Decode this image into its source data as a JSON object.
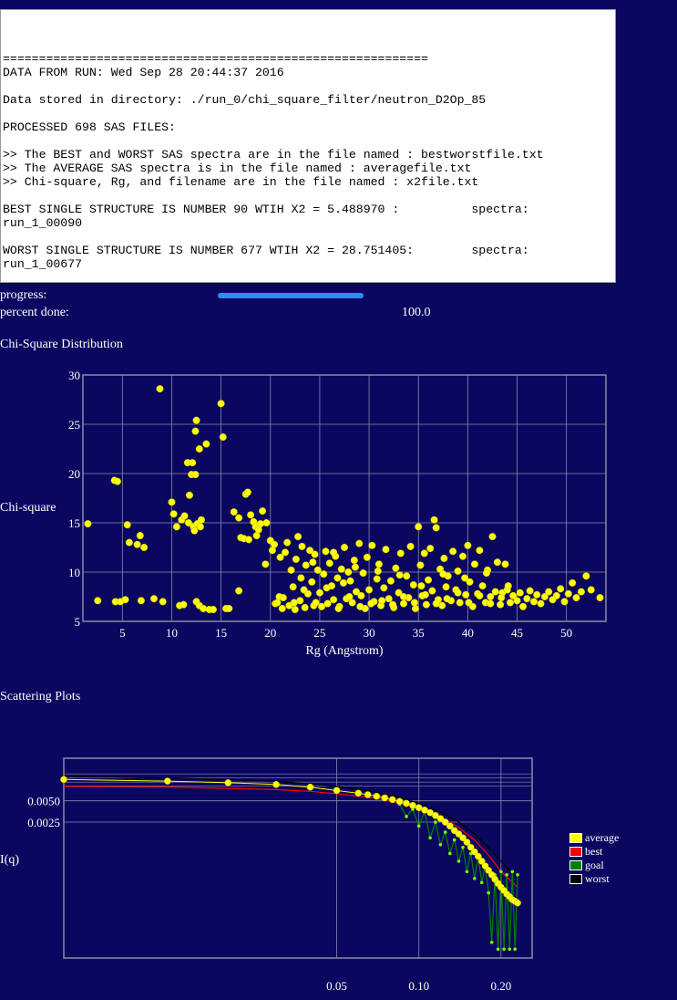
{
  "output": {
    "lines": [
      "===========================================================",
      "DATA FROM RUN: Wed Sep 28 20:44:37 2016",
      "",
      "Data stored in directory: ./run_0/chi_square_filter/neutron_D2Op_85",
      "",
      "PROCESSED 698 SAS FILES:",
      "",
      ">> The BEST and WORST SAS spectra are in the file named : bestworstfile.txt",
      ">> The AVERAGE SAS spectra is in the file named : averagefile.txt",
      ">> Chi-square, Rg, and filename are in the file named : x2file.txt",
      "",
      "BEST SINGLE STRUCTURE IS NUMBER 90 WTIH X2 = 5.488970 :          spectra:",
      "run_1_00090",
      "",
      "WORST SINGLE STRUCTURE IS NUMBER 677 WTIH X2 = 28.751405:        spectra:",
      "run_1_00677",
      "",
      "==========================================================="
    ]
  },
  "progress": {
    "label": "progress:",
    "fraction": 1.0,
    "percent_label": "percent done:",
    "percent_value": "100.0"
  },
  "chi_title": "Chi-Square Distribution",
  "scatter_title": "Scattering Plots",
  "colors": {
    "background": "#0b0760",
    "points": "#ffff00",
    "grid": "#8a8aa8",
    "progress": "#2f8bf0",
    "average": "#ffff00",
    "best": "#ff0000",
    "goal": "#008000",
    "worst": "#000000"
  },
  "chart_data": [
    {
      "type": "scatter",
      "title": "",
      "xlabel": "Rg (Angstrom)",
      "ylabel": "Chi-square",
      "xlim": [
        1,
        54
      ],
      "ylim": [
        5,
        30
      ],
      "xticks": [
        5,
        10,
        15,
        20,
        25,
        30,
        35,
        40,
        45,
        50
      ],
      "yticks": [
        5,
        10,
        15,
        20,
        25,
        30
      ],
      "grid": true,
      "points": [
        [
          1.5,
          14.9
        ],
        [
          2.5,
          7.1
        ],
        [
          4.2,
          19.3
        ],
        [
          4.5,
          19.2
        ],
        [
          4.3,
          7.0
        ],
        [
          4.8,
          7.0
        ],
        [
          5.3,
          7.2
        ],
        [
          5.5,
          14.8
        ],
        [
          5.7,
          13.0
        ],
        [
          6.5,
          12.8
        ],
        [
          6.8,
          13.7
        ],
        [
          7.2,
          12.5
        ],
        [
          6.9,
          7.1
        ],
        [
          8.2,
          7.3
        ],
        [
          8.8,
          28.6
        ],
        [
          9.1,
          7.0
        ],
        [
          10.0,
          17.1
        ],
        [
          10.2,
          15.9
        ],
        [
          10.5,
          14.6
        ],
        [
          10.8,
          6.6
        ],
        [
          11.2,
          6.7
        ],
        [
          11.0,
          15.3
        ],
        [
          11.3,
          15.7
        ],
        [
          11.6,
          21.1
        ],
        [
          11.7,
          15.0
        ],
        [
          11.8,
          17.8
        ],
        [
          12.0,
          19.9
        ],
        [
          12.1,
          21.1
        ],
        [
          12.2,
          14.6
        ],
        [
          12.3,
          14.2
        ],
        [
          12.4,
          19.9
        ],
        [
          12.4,
          24.3
        ],
        [
          12.5,
          25.4
        ],
        [
          12.6,
          14.9
        ],
        [
          12.8,
          22.5
        ],
        [
          12.9,
          14.6
        ],
        [
          12.5,
          7.0
        ],
        [
          12.8,
          6.6
        ],
        [
          13.0,
          15.3
        ],
        [
          13.2,
          6.3
        ],
        [
          13.5,
          23.0
        ],
        [
          13.8,
          6.2
        ],
        [
          14.2,
          6.2
        ],
        [
          15.0,
          27.1
        ],
        [
          15.2,
          23.7
        ],
        [
          15.5,
          6.3
        ],
        [
          15.8,
          6.3
        ],
        [
          16.3,
          16.1
        ],
        [
          16.8,
          15.5
        ],
        [
          17.0,
          13.5
        ],
        [
          16.8,
          8.1
        ],
        [
          17.3,
          13.4
        ],
        [
          17.5,
          17.9
        ],
        [
          17.7,
          18.1
        ],
        [
          17.8,
          13.3
        ],
        [
          18.0,
          15.8
        ],
        [
          18.3,
          15.1
        ],
        [
          18.5,
          14.6
        ],
        [
          18.6,
          13.7
        ],
        [
          18.8,
          14.3
        ],
        [
          19.0,
          14.9
        ],
        [
          19.2,
          16.2
        ],
        [
          19.5,
          10.8
        ],
        [
          19.6,
          15.0
        ],
        [
          20.0,
          13.2
        ],
        [
          20.2,
          12.2
        ],
        [
          20.4,
          12.8
        ],
        [
          20.5,
          6.8
        ],
        [
          20.7,
          6.9
        ],
        [
          20.9,
          7.5
        ],
        [
          21.0,
          11.5
        ],
        [
          21.2,
          6.3
        ],
        [
          21.3,
          7.4
        ],
        [
          21.5,
          12.0
        ],
        [
          21.7,
          13.0
        ],
        [
          21.9,
          6.6
        ],
        [
          22.1,
          10.2
        ],
        [
          22.3,
          8.5
        ],
        [
          22.5,
          6.2
        ],
        [
          22.6,
          11.3
        ],
        [
          22.8,
          13.6
        ],
        [
          23.0,
          7.1
        ],
        [
          23.1,
          9.4
        ],
        [
          23.2,
          12.6
        ],
        [
          23.5,
          6.4
        ],
        [
          23.6,
          10.7
        ],
        [
          23.8,
          7.8
        ],
        [
          24.0,
          12.2
        ],
        [
          24.2,
          9.0
        ],
        [
          24.4,
          6.6
        ],
        [
          24.5,
          11.8
        ],
        [
          24.8,
          10.2
        ],
        [
          25.0,
          7.9
        ],
        [
          25.2,
          6.5
        ],
        [
          25.4,
          9.8
        ],
        [
          25.6,
          12.1
        ],
        [
          25.8,
          6.8
        ],
        [
          26.0,
          10.9
        ],
        [
          26.2,
          8.6
        ],
        [
          26.4,
          7.2
        ],
        [
          26.6,
          11.6
        ],
        [
          26.8,
          9.4
        ],
        [
          27.0,
          6.5
        ],
        [
          27.2,
          10.3
        ],
        [
          27.4,
          8.9
        ],
        [
          27.5,
          12.5
        ],
        [
          27.7,
          7.3
        ],
        [
          27.9,
          10.0
        ],
        [
          28.1,
          9.1
        ],
        [
          28.3,
          6.9
        ],
        [
          28.5,
          11.2
        ],
        [
          28.7,
          8.0
        ],
        [
          29.0,
          12.9
        ],
        [
          29.2,
          7.6
        ],
        [
          29.4,
          9.9
        ],
        [
          29.6,
          6.3
        ],
        [
          29.8,
          11.5
        ],
        [
          30.0,
          8.2
        ],
        [
          30.3,
          12.7
        ],
        [
          30.5,
          7.0
        ],
        [
          30.8,
          9.3
        ],
        [
          31.0,
          10.8
        ],
        [
          31.2,
          6.6
        ],
        [
          31.5,
          8.4
        ],
        [
          31.7,
          12.3
        ],
        [
          32.0,
          7.3
        ],
        [
          32.2,
          9.1
        ],
        [
          32.5,
          6.4
        ],
        [
          32.7,
          10.4
        ],
        [
          33.0,
          7.9
        ],
        [
          33.2,
          11.9
        ],
        [
          33.5,
          6.8
        ],
        [
          33.8,
          9.6
        ],
        [
          34.0,
          7.4
        ],
        [
          34.2,
          12.6
        ],
        [
          34.5,
          8.7
        ],
        [
          34.7,
          6.3
        ],
        [
          35.0,
          14.6
        ],
        [
          35.2,
          10.7
        ],
        [
          35.4,
          7.6
        ],
        [
          35.6,
          11.9
        ],
        [
          35.8,
          6.7
        ],
        [
          36.0,
          9.2
        ],
        [
          36.2,
          12.4
        ],
        [
          36.4,
          8.1
        ],
        [
          36.6,
          15.3
        ],
        [
          36.8,
          14.5
        ],
        [
          37.0,
          7.2
        ],
        [
          37.2,
          10.3
        ],
        [
          37.4,
          6.6
        ],
        [
          37.6,
          11.4
        ],
        [
          37.8,
          8.5
        ],
        [
          38.0,
          9.6
        ],
        [
          38.3,
          7.1
        ],
        [
          38.5,
          12.1
        ],
        [
          38.8,
          8.2
        ],
        [
          39.0,
          10.1
        ],
        [
          39.2,
          6.9
        ],
        [
          39.5,
          11.6
        ],
        [
          39.8,
          7.7
        ],
        [
          40.0,
          12.7
        ],
        [
          40.2,
          9.0
        ],
        [
          40.5,
          6.5
        ],
        [
          40.7,
          10.8
        ],
        [
          41.0,
          7.8
        ],
        [
          41.2,
          12.2
        ],
        [
          41.5,
          8.6
        ],
        [
          41.8,
          6.9
        ],
        [
          42.0,
          10.2
        ],
        [
          42.3,
          7.5
        ],
        [
          42.5,
          13.6
        ],
        [
          42.8,
          8.0
        ],
        [
          43.0,
          11.0
        ],
        [
          43.3,
          6.7
        ],
        [
          43.5,
          7.9
        ],
        [
          43.8,
          10.8
        ],
        [
          44.0,
          8.2
        ],
        [
          44.3,
          6.9
        ],
        [
          44.6,
          7.6
        ],
        [
          45.0,
          7.1
        ],
        [
          45.3,
          7.9
        ],
        [
          45.6,
          6.5
        ],
        [
          46.0,
          7.3
        ],
        [
          46.3,
          8.1
        ],
        [
          46.7,
          7.0
        ],
        [
          47.0,
          7.7
        ],
        [
          47.4,
          6.8
        ],
        [
          47.8,
          7.5
        ],
        [
          48.2,
          8.0
        ],
        [
          48.6,
          7.2
        ],
        [
          49.0,
          7.6
        ],
        [
          49.4,
          8.3
        ],
        [
          49.8,
          7.0
        ],
        [
          50.2,
          7.8
        ],
        [
          50.6,
          8.9
        ],
        [
          51.0,
          7.4
        ],
        [
          51.5,
          8.0
        ],
        [
          52.0,
          9.6
        ],
        [
          52.5,
          8.2
        ],
        [
          53.4,
          7.4
        ],
        [
          22.4,
          6.9
        ],
        [
          23.4,
          8.2
        ],
        [
          24.6,
          6.9
        ],
        [
          25.7,
          8.4
        ],
        [
          26.9,
          6.3
        ],
        [
          28.0,
          7.5
        ],
        [
          29.1,
          6.5
        ],
        [
          30.2,
          6.8
        ],
        [
          31.3,
          7.1
        ],
        [
          32.4,
          6.7
        ],
        [
          33.5,
          7.5
        ],
        [
          34.6,
          6.9
        ],
        [
          35.7,
          7.7
        ],
        [
          36.8,
          6.8
        ],
        [
          37.9,
          7.3
        ],
        [
          39.0,
          7.9
        ],
        [
          40.1,
          6.9
        ],
        [
          41.2,
          7.6
        ],
        [
          42.3,
          6.8
        ],
        [
          43.4,
          7.4
        ],
        [
          24.3,
          11.0
        ],
        [
          26.4,
          12.0
        ],
        [
          28.6,
          10.5
        ],
        [
          30.9,
          10.1
        ],
        [
          33.1,
          9.7
        ],
        [
          35.3,
          8.6
        ],
        [
          37.5,
          9.8
        ],
        [
          39.7,
          9.4
        ],
        [
          41.9,
          9.9
        ],
        [
          44.1,
          8.6
        ]
      ]
    },
    {
      "type": "line",
      "title": "",
      "xlabel": "",
      "ylabel": "I(q)",
      "xscale": "log",
      "yscale": "log",
      "xtick_labels": [
        "0.05",
        "0.10",
        "0.20"
      ],
      "ytick_labels": [
        "0.0050",
        "0.0025"
      ],
      "legend": "right",
      "series": [
        {
          "name": "average",
          "x": [
            0.005,
            0.012,
            0.02,
            0.03,
            0.04,
            0.05,
            0.06,
            0.065,
            0.07,
            0.075,
            0.08,
            0.085,
            0.09,
            0.095,
            0.1,
            0.105,
            0.11,
            0.115,
            0.12,
            0.125,
            0.13,
            0.135,
            0.14,
            0.145,
            0.15,
            0.155,
            0.16,
            0.165,
            0.17,
            0.175,
            0.18,
            0.185,
            0.19,
            0.195,
            0.2,
            0.205,
            0.21,
            0.215,
            0.22,
            0.225,
            0.23
          ],
          "y": [
            0.01,
            0.0095,
            0.009,
            0.0085,
            0.0078,
            0.007,
            0.0064,
            0.0061,
            0.0058,
            0.0055,
            0.0052,
            0.0049,
            0.0046,
            0.0043,
            0.004,
            0.0037,
            0.0034,
            0.0031,
            0.0028,
            0.0025,
            0.0022,
            0.0019,
            0.0017,
            0.0015,
            0.0013,
            0.0011,
            0.00095,
            0.00082,
            0.0007,
            0.0006,
            0.00052,
            0.00045,
            0.00039,
            0.00034,
            0.0003,
            0.00027,
            0.00024,
            0.00022,
            0.0002,
            0.00019,
            0.00018
          ]
        },
        {
          "name": "best",
          "x": [
            0.005,
            0.012,
            0.02,
            0.03,
            0.04,
            0.05,
            0.06,
            0.07,
            0.08,
            0.09,
            0.1,
            0.12,
            0.14,
            0.16,
            0.18,
            0.2,
            0.23
          ],
          "y": [
            0.008,
            0.0078,
            0.0075,
            0.0072,
            0.0068,
            0.0063,
            0.0058,
            0.0054,
            0.0049,
            0.0044,
            0.0039,
            0.003,
            0.0021,
            0.0014,
            0.00085,
            0.0005,
            0.0003
          ]
        },
        {
          "name": "goal",
          "x": [
            0.085,
            0.09,
            0.095,
            0.1,
            0.105,
            0.11,
            0.115,
            0.12,
            0.125,
            0.13,
            0.135,
            0.14,
            0.145,
            0.15,
            0.155,
            0.16,
            0.165,
            0.17,
            0.175,
            0.18,
            0.185,
            0.19,
            0.195,
            0.2,
            0.205,
            0.21,
            0.215,
            0.22,
            0.225,
            0.23
          ],
          "y": [
            0.0045,
            0.003,
            0.0038,
            0.0022,
            0.0035,
            0.0015,
            0.0025,
            0.0012,
            0.0018,
            0.0009,
            0.0014,
            0.0007,
            0.0011,
            0.0005,
            0.0009,
            0.0004,
            0.0008,
            0.00035,
            0.0006,
            0.00025,
            5e-05,
            0.00045,
            4e-05,
            0.0005,
            4e-05,
            0.00045,
            4e-05,
            0.0005,
            4e-05,
            0.00045
          ]
        },
        {
          "name": "worst",
          "x": [
            0.005,
            0.012,
            0.02,
            0.03,
            0.04,
            0.05,
            0.06,
            0.07,
            0.08,
            0.09,
            0.1,
            0.12,
            0.14,
            0.16,
            0.18,
            0.2,
            0.23
          ],
          "y": [
            0.011,
            0.0105,
            0.01,
            0.0094,
            0.0087,
            0.008,
            0.0073,
            0.0066,
            0.0059,
            0.0052,
            0.0046,
            0.0035,
            0.0025,
            0.0017,
            0.0011,
            0.0007,
            0.0004
          ]
        }
      ]
    }
  ]
}
